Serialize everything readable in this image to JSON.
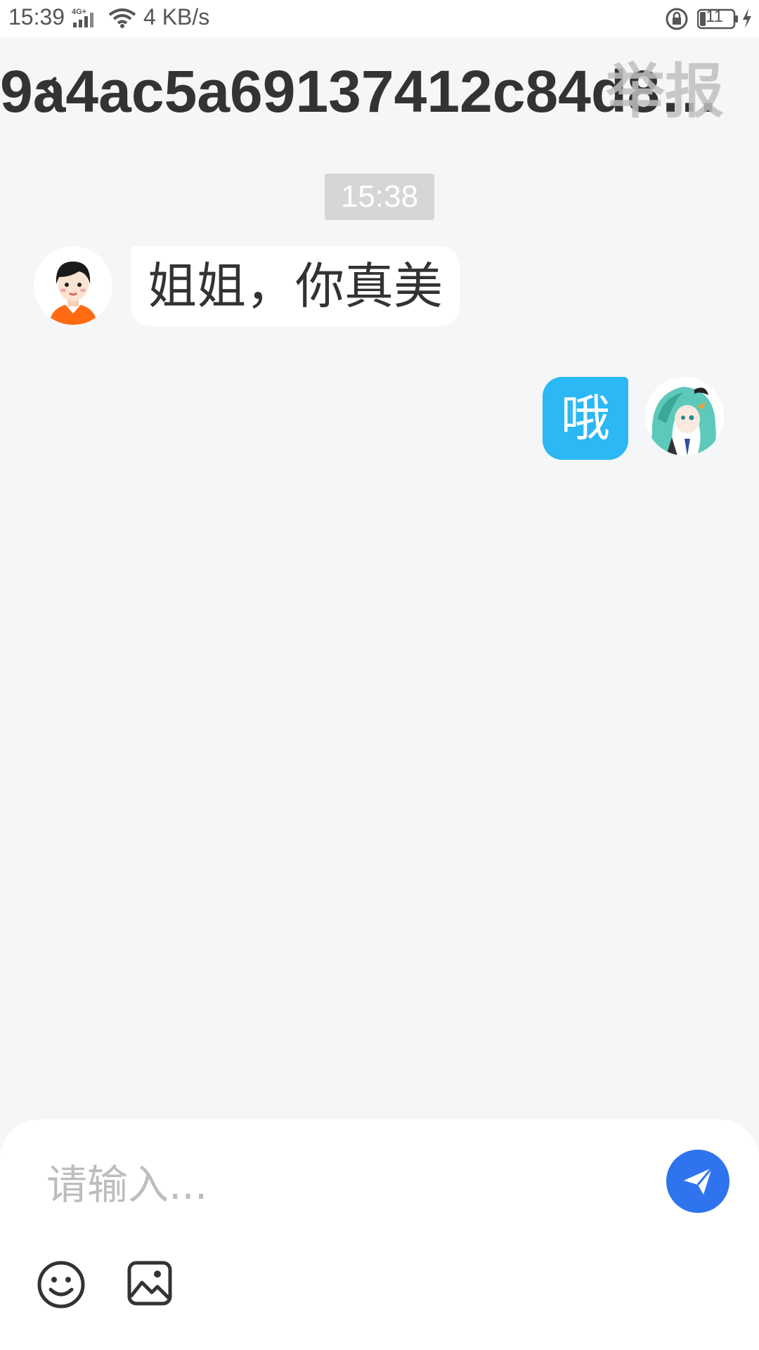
{
  "status_bar": {
    "time": "15:39",
    "network_type": "4G+",
    "speed": "4 KB/s",
    "battery_level": "11"
  },
  "header": {
    "title": "9a4ac5a69137412c84d8b...",
    "report_label": "举报"
  },
  "chat": {
    "timestamp": "15:38",
    "messages": [
      {
        "side": "left",
        "text": "姐姐，你真美"
      },
      {
        "side": "right",
        "text": "哦"
      }
    ]
  },
  "composer": {
    "placeholder": "请输入...",
    "value": ""
  },
  "colors": {
    "accent": "#2f73ee",
    "sent_bubble": "#2bb8f4",
    "background": "#f5f6f8"
  },
  "icons": [
    "back-arrow-icon",
    "send-icon",
    "emoji-icon",
    "image-icon",
    "wifi-icon",
    "signal-icon",
    "battery-icon"
  ]
}
